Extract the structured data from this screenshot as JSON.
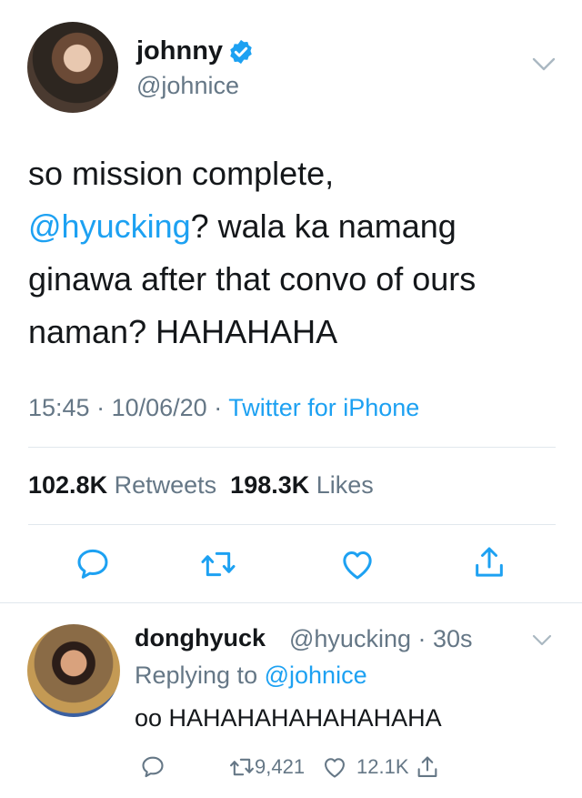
{
  "tweet": {
    "display_name": "johnny",
    "handle": "@johnice",
    "text_line1": "so mission complete,",
    "mention": "@hyucking",
    "text_line2_rest": "? wala ka namang",
    "text_line3": "ginawa after that convo of ours",
    "text_line4": "naman? HAHAHAHA",
    "time": "15:45",
    "date": "10/06/20",
    "source": "Twitter for iPhone",
    "retweets_count": "102.8K",
    "retweets_label": "Retweets",
    "likes_count": "198.3K",
    "likes_label": "Likes"
  },
  "reply": {
    "display_name": "donghyuck",
    "handle": "@hyucking",
    "time_ago": "30s",
    "replying_label": "Replying to",
    "replying_to": "@johnice",
    "text": "oo HAHAHAHAHAHAHAHA",
    "retweets": "9,421",
    "likes": "12.1K"
  },
  "colors": {
    "accent": "#1da1f2",
    "secondary": "#657786",
    "divider": "#e1e8ed"
  },
  "icons": [
    "verified-badge-icon",
    "chevron-down-icon",
    "reply-icon",
    "retweet-icon",
    "like-icon",
    "share-icon"
  ]
}
